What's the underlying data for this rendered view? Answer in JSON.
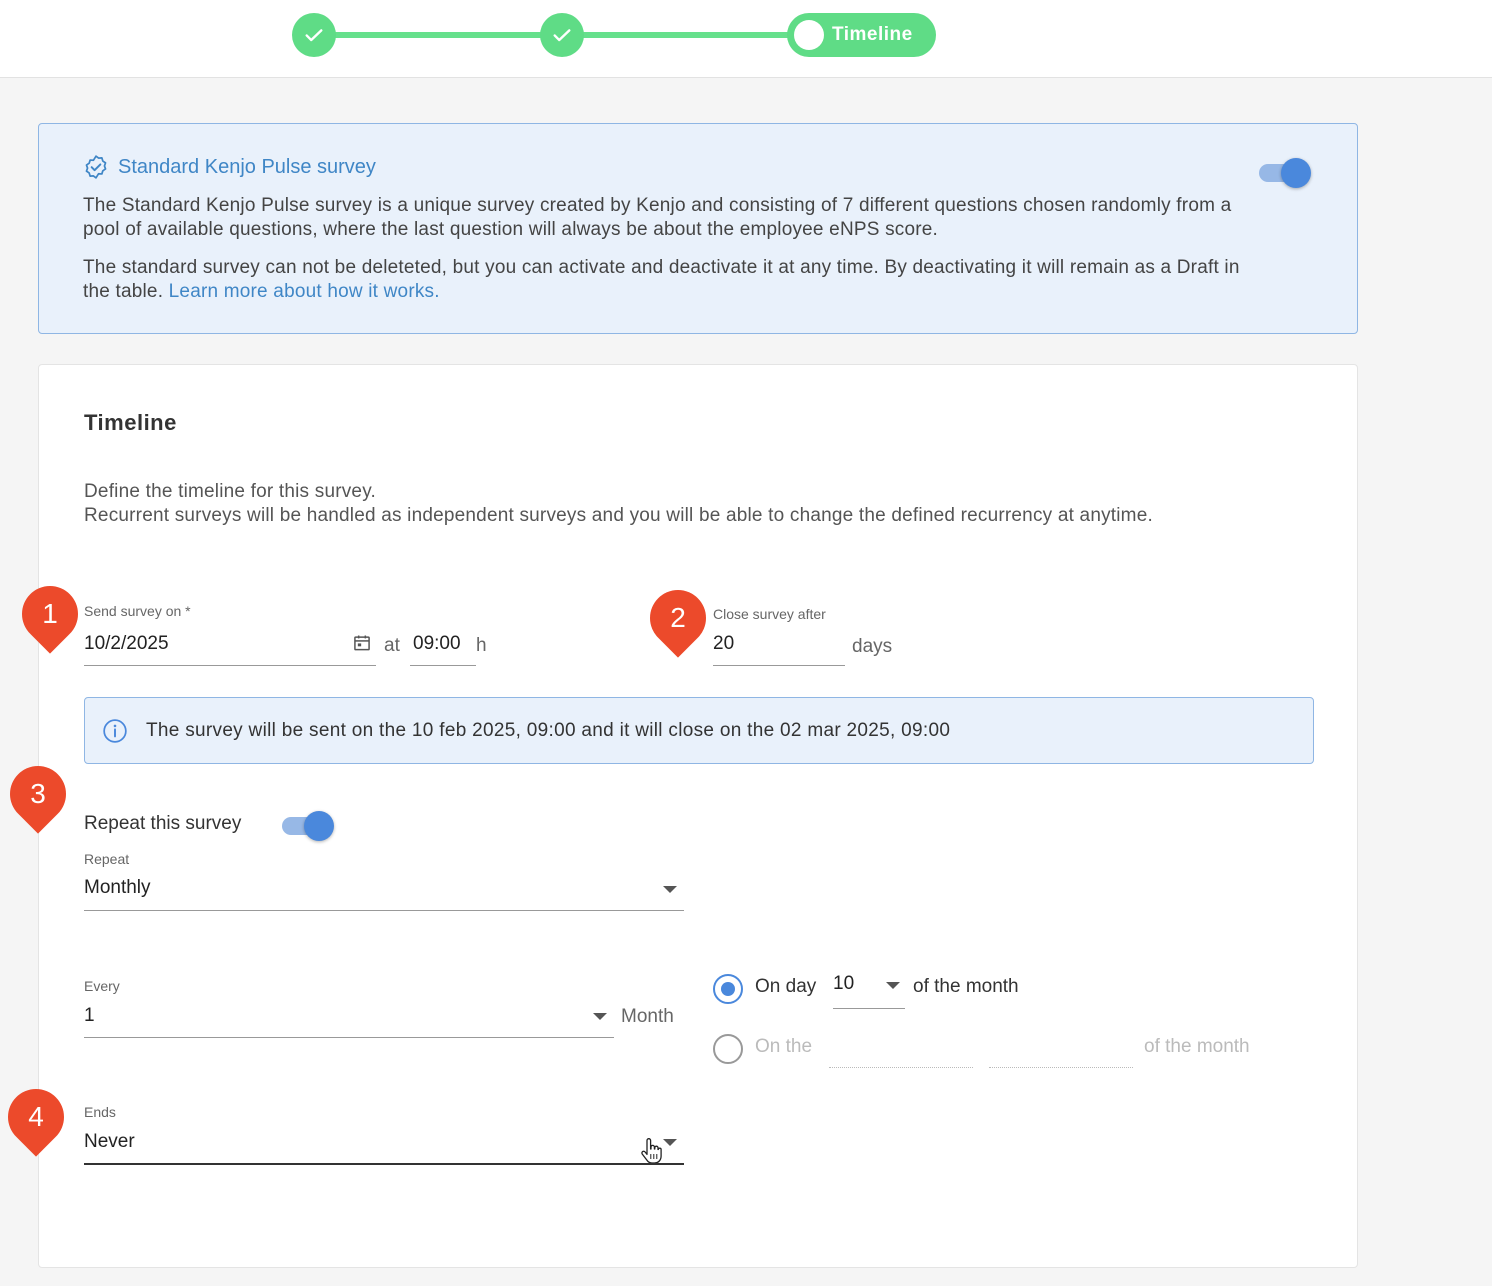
{
  "stepper": {
    "current_label": "Timeline"
  },
  "standard_survey": {
    "title": "Standard Kenjo Pulse survey",
    "paragraph1": "The Standard Kenjo Pulse survey is a unique survey created by Kenjo and consisting of 7 different questions chosen randomly from a pool of available questions, where the last question will always be about the employee eNPS score.",
    "paragraph2": "The standard survey can not be deleteted, but you can activate and deactivate it at any time. By deactivating it will remain as a Draft in the table.",
    "learn_more": "Learn more about how it works.",
    "active": true
  },
  "timeline": {
    "title": "Timeline",
    "desc_line1": "Define the timeline for this survey.",
    "desc_line2": "Recurrent surveys will be handled as independent surveys and you will be able to change the defined recurrency at anytime.",
    "send_label": "Send survey on *",
    "send_date": "10/2/2025",
    "at_label": "at",
    "send_time": "09:00",
    "h_label": "h",
    "close_label": "Close survey after",
    "close_value": "20",
    "days_label": "days",
    "summary": "The survey will be sent on the 10 feb 2025, 09:00 and it will close on the 02 mar 2025, 09:00",
    "repeat_label": "Repeat this survey",
    "repeat_on": true,
    "repeat_select_label": "Repeat",
    "repeat_value": "Monthly",
    "every_label": "Every",
    "every_value": "1",
    "month_label": "Month",
    "on_day_label": "On day",
    "on_day_value": "10",
    "of_month_label": "of the month",
    "on_the_label": "On the",
    "of_month_label2": "of the month",
    "ends_label": "Ends",
    "ends_value": "Never"
  },
  "markers": [
    "1",
    "2",
    "3",
    "4"
  ],
  "colors": {
    "stepper_green": "#5fdc86",
    "accent_blue": "#4a88dc",
    "link_blue": "#3f86c6",
    "info_bg": "#e9f1fb",
    "marker_red": "#ec4a2b"
  }
}
